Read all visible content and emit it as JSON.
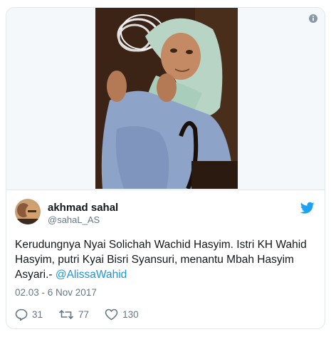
{
  "media": {
    "icons": {
      "info": "info-icon"
    }
  },
  "author": {
    "name": "akhmad sahal",
    "handle": "@sahaL_AS",
    "icons": {
      "platform": "twitter-bird-icon"
    }
  },
  "tweet": {
    "text": "Kerudungnya Nyai Solichah Wachid Hasyim. Istri KH Wahid Hasyim, putri Kyai Bisri Syansuri, menantu Mbah Hasyim Asyari.- ",
    "mention": "@AlissaWahid",
    "timestamp": "02.03 - 6 Nov 2017"
  },
  "actions": {
    "replies": "31",
    "retweets": "77",
    "likes": "130",
    "icons": {
      "reply": "reply-icon",
      "retweet": "retweet-icon",
      "like": "heart-icon"
    }
  },
  "colors": {
    "link": "#1b95e0",
    "text": "#14171a",
    "muted": "#657786",
    "border": "#e1e8ed",
    "bird": "#1da1f2"
  }
}
